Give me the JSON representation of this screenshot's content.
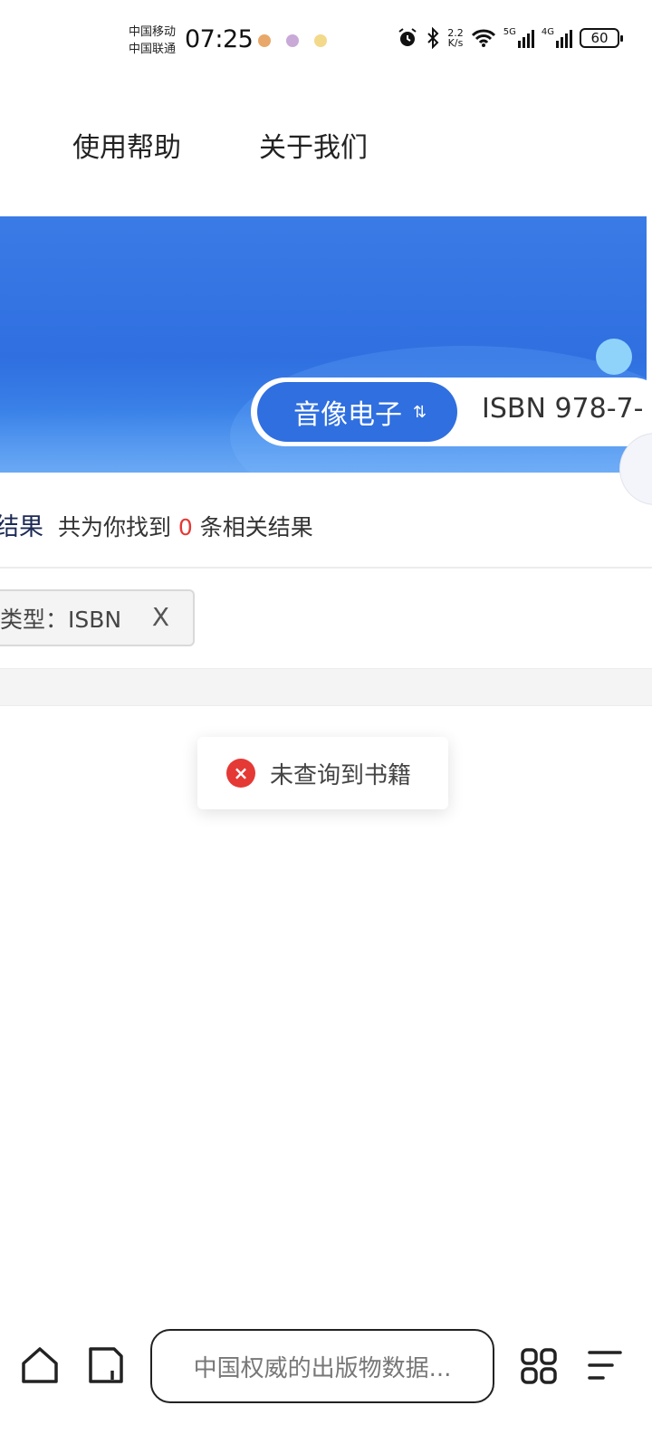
{
  "status_bar": {
    "carrier_1": "中国移动",
    "carrier_2": "中国联通",
    "time": "07:25",
    "net_speed_value": "2.2",
    "net_speed_unit": "K/s",
    "net_5g": "5G",
    "net_4g": "4G",
    "battery": "60"
  },
  "nav": {
    "help": "使用帮助",
    "about": "关于我们"
  },
  "search": {
    "category": "音像电子",
    "swap_symbol": "⇅",
    "query": "ISBN 978-7-"
  },
  "results": {
    "title": "结果",
    "prefix": "共为你找到",
    "count": "0",
    "suffix": "条相关结果"
  },
  "filter": {
    "label": "类型：ISBN",
    "remove": "X"
  },
  "toast": {
    "icon": "×",
    "message": "未查询到书籍"
  },
  "browser_bar": {
    "url_text": "中国权威的出版物数据..."
  },
  "colors": {
    "brand_blue": "#2f6fe0",
    "count_red": "#e53935",
    "error_red": "#e53935"
  }
}
